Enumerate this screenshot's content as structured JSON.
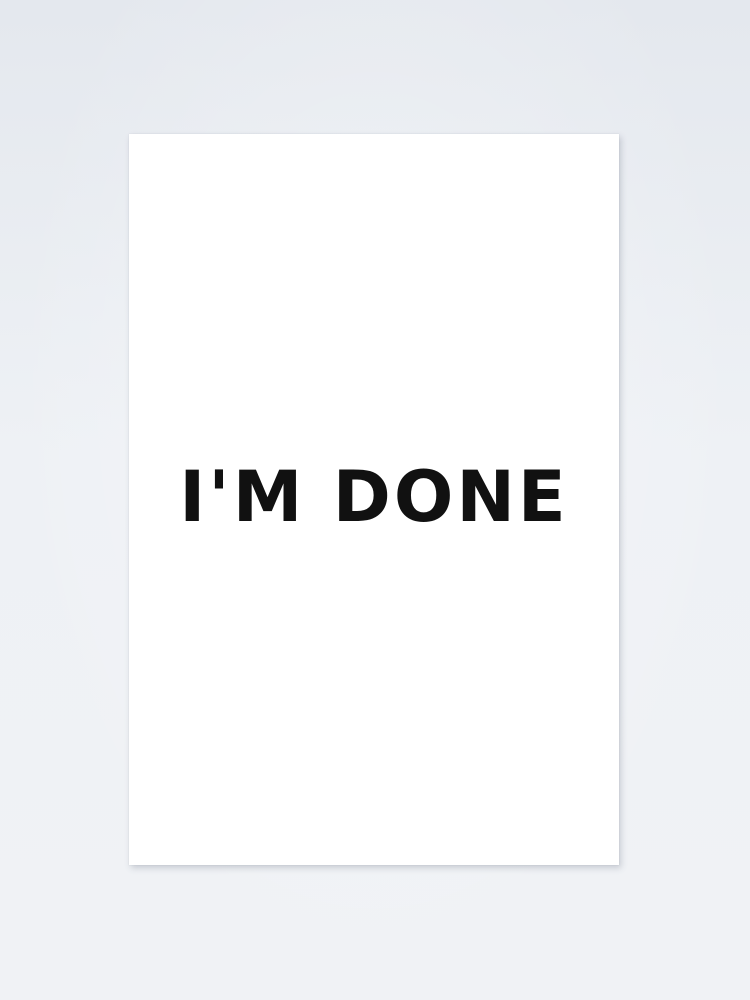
{
  "poster": {
    "text": "I'M DONE"
  },
  "colors": {
    "wall": "#e9ecf1",
    "paper": "#ffffff",
    "ink": "#111111"
  }
}
